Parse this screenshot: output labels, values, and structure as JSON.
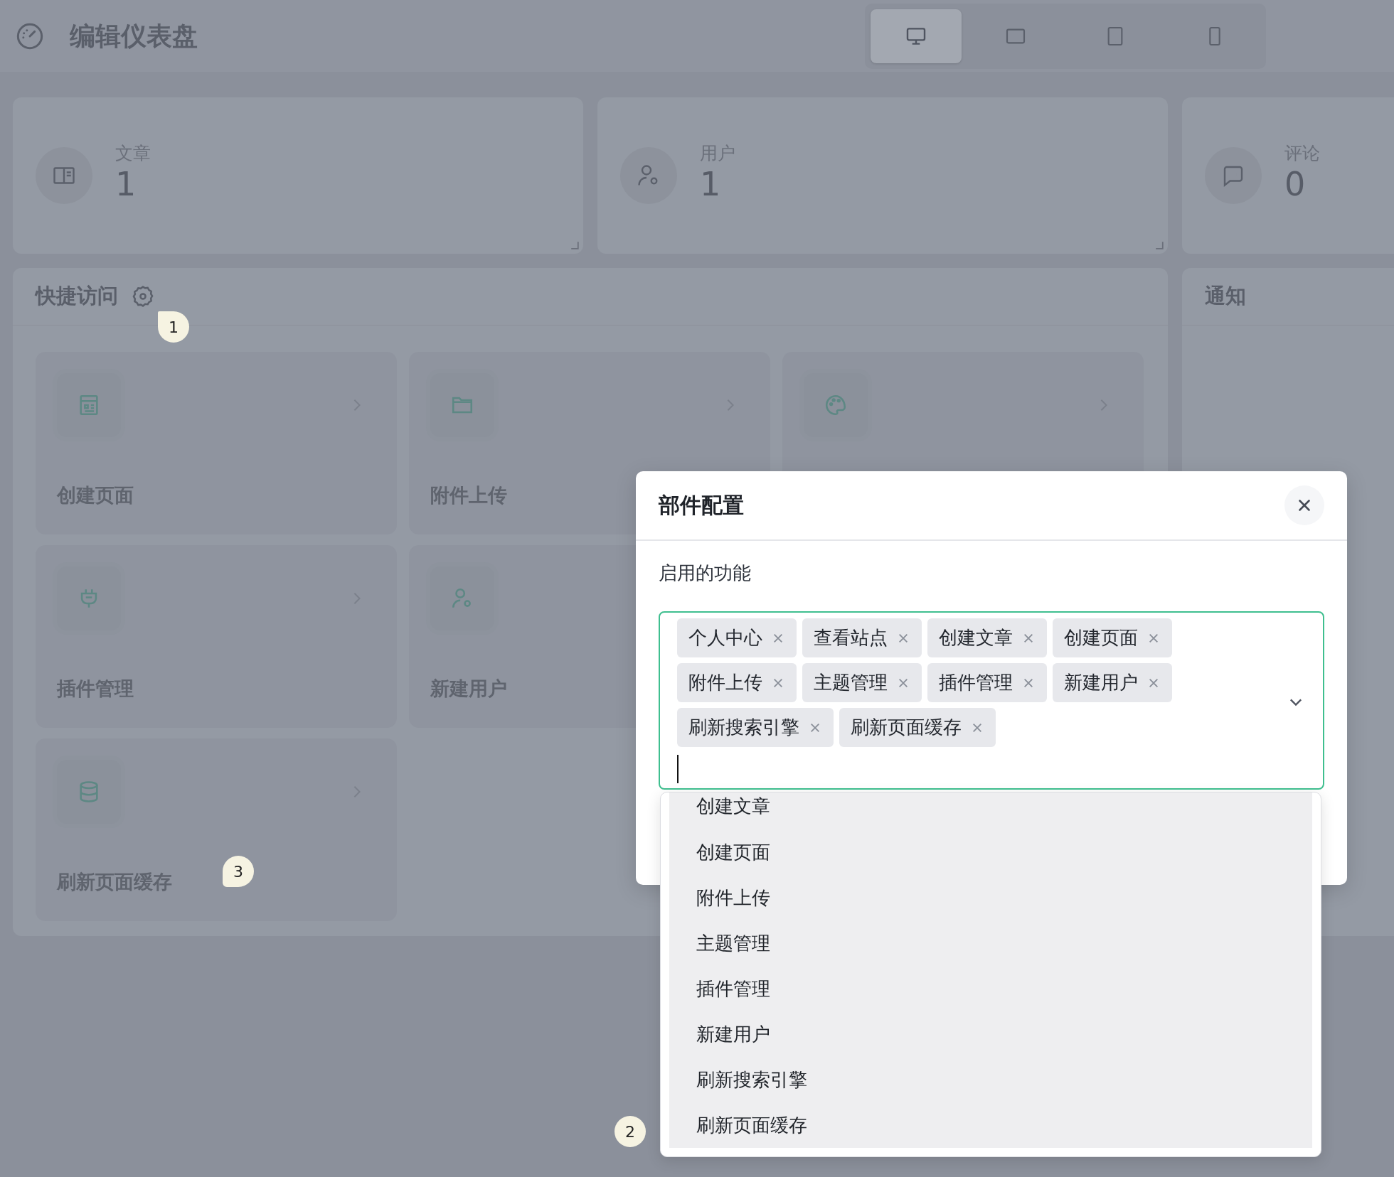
{
  "header": {
    "title": "编辑仪表盘",
    "devices": [
      {
        "kind": "desktop",
        "selected": true
      },
      {
        "kind": "tablet-landscape",
        "selected": false
      },
      {
        "kind": "tablet",
        "selected": false
      },
      {
        "kind": "phone",
        "selected": false
      }
    ]
  },
  "stats": [
    {
      "kind": "post",
      "label": "文章",
      "value": "1"
    },
    {
      "kind": "user",
      "label": "用户",
      "value": "1"
    },
    {
      "kind": "comment",
      "label": "评论",
      "value": "0"
    }
  ],
  "quick_access": {
    "title": "快捷访问",
    "rows": [
      [
        {
          "kind": "page",
          "label": "创建页面"
        },
        {
          "kind": "folder",
          "label": "附件上传"
        },
        {
          "kind": "palette"
        }
      ],
      [
        {
          "kind": "plugin",
          "label": "插件管理"
        },
        {
          "kind": "user",
          "label": "新建用户"
        }
      ],
      [
        {
          "kind": "database",
          "label": "刷新页面缓存"
        }
      ]
    ]
  },
  "notifications": {
    "title": "通知"
  },
  "annotations": [
    {
      "label": "1"
    },
    {
      "label": "2"
    },
    {
      "label": "3"
    }
  ],
  "dialog": {
    "title": "部件配置",
    "field_label": "启用的功能",
    "tags": [
      {
        "label": "个人中心"
      },
      {
        "label": "查看站点"
      },
      {
        "label": "创建文章"
      },
      {
        "label": "创建页面"
      },
      {
        "label": "附件上传"
      },
      {
        "label": "主题管理"
      },
      {
        "label": "插件管理"
      },
      {
        "label": "新建用户"
      },
      {
        "label": "刷新搜索引擎"
      },
      {
        "label": "刷新页面缓存"
      }
    ],
    "options": [
      {
        "label": "创建文章",
        "selected": true
      },
      {
        "label": "创建页面",
        "selected": true
      },
      {
        "label": "附件上传",
        "selected": true
      },
      {
        "label": "主题管理",
        "selected": true
      },
      {
        "label": "插件管理",
        "selected": true
      },
      {
        "label": "新建用户",
        "selected": true
      },
      {
        "label": "刷新搜索引擎",
        "selected": true
      },
      {
        "label": "刷新页面缓存",
        "selected": true
      }
    ]
  }
}
